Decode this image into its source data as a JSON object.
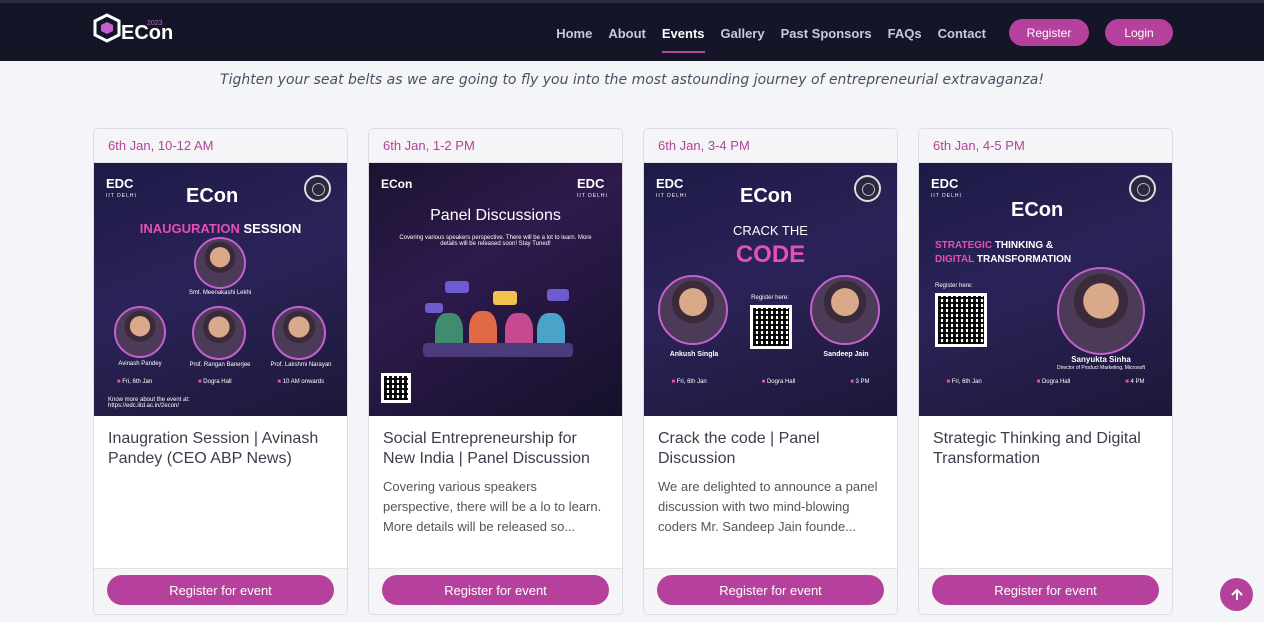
{
  "brand": {
    "logo_text": "ECon",
    "logo_year": "2023"
  },
  "nav": {
    "links": [
      "Home",
      "About",
      "Events",
      "Gallery",
      "Past Sponsors",
      "FAQs",
      "Contact"
    ],
    "register": "Register",
    "login": "Login"
  },
  "tagline": "Tighten your seat belts as we are going to fly you into the most astounding journey of entrepreneurial extravaganza!",
  "events": [
    {
      "date": "6th Jan, 10-12 AM",
      "title": "Inaugration Session | Avinash Pandey (CEO ABP News)",
      "desc": "",
      "button": "Register for event",
      "poster": {
        "edc": "EDC",
        "edc_sub": "IIT DELHI",
        "heading_a": "INAUGURATION",
        "heading_b": "SESSION",
        "speaker_main": "Smt. Meenakashi Lekhi",
        "speakers": [
          "Avinash Pandey",
          "Prof. Rangan Banerjee",
          "Prof. Lakshmi Narayan"
        ],
        "info": [
          "Fri, 6th Jan",
          "Dogra Hall",
          "10 AM onwards"
        ],
        "footer": "Know more about the event at: https://edc.iitd.ac.in/2econ/"
      }
    },
    {
      "date": "6th Jan, 1-2 PM",
      "title": "Social Entrepreneurship for New India | Panel Discussion",
      "desc": "Covering various speakers perspective, there will be a lo to learn. More details will be released so...",
      "button": "Register for event",
      "poster": {
        "edc": "EDC",
        "edc_sub": "IIT DELHI",
        "heading": "Panel Discussions",
        "sub": "Covering various speakers perspective. There will be a lot to learn. More details will be released soon! Stay Tuned!"
      }
    },
    {
      "date": "6th Jan, 3-4 PM",
      "title": "Crack the code | Panel Discussion",
      "desc": "We are delighted to announce a panel discussion with two mind-blowing coders Mr. Sandeep Jain founde...",
      "button": "Register for event",
      "poster": {
        "edc": "EDC",
        "edc_sub": "IIT DELHI",
        "heading_a": "CRACK THE",
        "heading_b": "CODE",
        "register_here": "Register here:",
        "speakers": [
          "Ankush Singla",
          "Sandeep Jain"
        ],
        "info": [
          "Fri, 6th Jan",
          "Dogra Hall",
          "3 PM"
        ]
      }
    },
    {
      "date": "6th Jan, 4-5 PM",
      "title": "Strategic Thinking and Digital Transformation",
      "desc": "",
      "button": "Register for event",
      "poster": {
        "edc": "EDC",
        "edc_sub": "IIT DELHI",
        "heading_a": "STRATEGIC",
        "heading_b": "THINKING &",
        "heading_c": "DIGITAL",
        "heading_d": "TRANSFORMATION",
        "register_here": "Register here:",
        "speaker": "Sanyukta Sinha",
        "speaker_role": "Director of Product Marketing, Microsoft",
        "info": [
          "Fri, 6th Jan",
          "Dogra Hall",
          "4 PM"
        ]
      }
    }
  ],
  "scroll_top_icon": "arrow-up-icon"
}
